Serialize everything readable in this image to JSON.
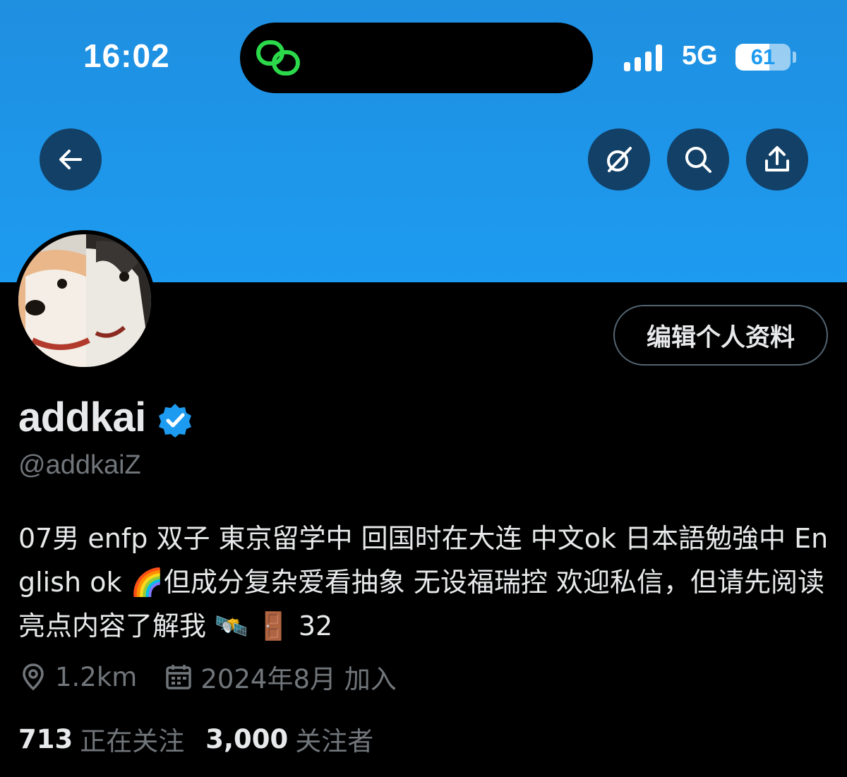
{
  "status_bar": {
    "time": "16:02",
    "network": "5G",
    "battery_percent": 61,
    "battery_label": "61"
  },
  "nav": {
    "icons": [
      "back-arrow-icon",
      "grok-icon",
      "search-icon",
      "share-icon"
    ]
  },
  "profile": {
    "edit_button_label": "编辑个人资料",
    "display_name": "addkai",
    "handle": "@addkaiZ",
    "bio_emoji_and_text": "07男 enfp 双子 東京留学中 回国时在大连 中文ok 日本語勉強中 English ok 🌈但成分复杂爱看抽象 无设福瑞控 欢迎私信，但请先阅读亮点内容了解我 🛰️ 🚪 32",
    "location": "1.2km",
    "joined": "2024年8月 加入",
    "following_count": "713",
    "following_label": "正在关注",
    "followers_count": "3,000",
    "followers_label": "关注者"
  },
  "colors": {
    "banner": "#1d9bf0",
    "verified": "#1d9bf0",
    "secondary_text": "#71767b",
    "island_accent": "#2bd94a"
  }
}
